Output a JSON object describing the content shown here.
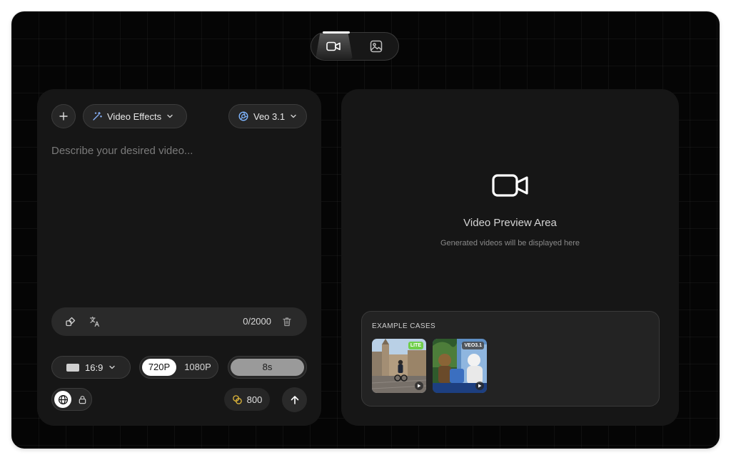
{
  "mode_switch": {
    "active": "video",
    "video_icon": "video-camera-icon",
    "image_icon": "image-icon"
  },
  "composer": {
    "add_icon": "plus-icon",
    "effects": {
      "label": "Video Effects",
      "icon": "magic-wand-icon"
    },
    "model": {
      "label": "Veo 3.1",
      "icon": "veo-logo-icon"
    },
    "prompt_placeholder": "Describe your desired video...",
    "tools": {
      "enhance_icon": "shapes-icon",
      "translate_icon": "translate-icon",
      "char_count": "0/2000",
      "clear_icon": "trash-icon"
    },
    "aspect_ratio": "16:9",
    "resolution": {
      "options": [
        "720P",
        "1080P"
      ],
      "selected": "720P"
    },
    "duration": {
      "label": "8s",
      "fill_fraction": 1.0
    },
    "visibility": {
      "public_icon": "globe-icon",
      "private_icon": "lock-icon",
      "selected": "public"
    },
    "credits": {
      "value": "800",
      "icon": "coins-icon"
    },
    "submit_icon": "arrow-up-icon"
  },
  "preview": {
    "icon": "video-camera-icon",
    "title": "Video Preview Area",
    "subtitle": "Generated videos will be displayed here",
    "examples_title": "EXAMPLE CASES",
    "examples": [
      {
        "badge": "LITE",
        "badge_color": "#6fcf4a"
      },
      {
        "badge": "VEO3.1",
        "badge_color": "#555555"
      }
    ]
  },
  "colors": {
    "background": "#050505",
    "panel": "#161616",
    "accent_white": "#ffffff",
    "coin": "#e2b93b",
    "effects_icon": "#8ab4ff"
  }
}
